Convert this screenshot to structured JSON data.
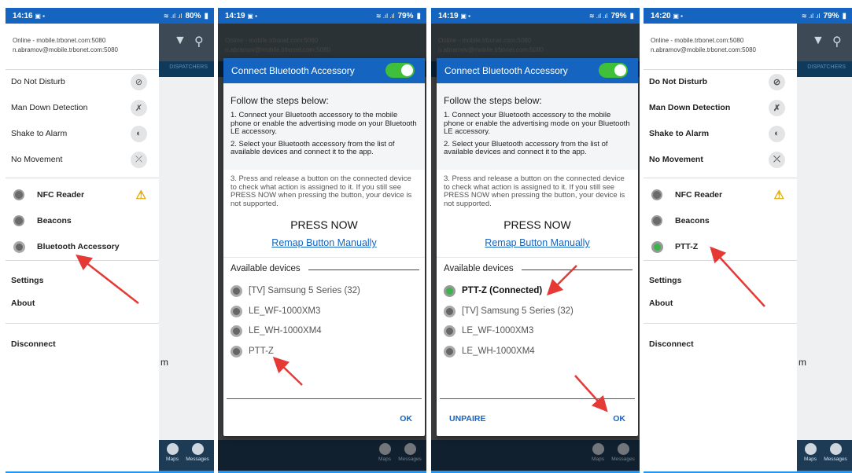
{
  "colors": {
    "accent": "#1565c0",
    "toggle_on": "#3fbf3a",
    "arrow": "#e53935",
    "warning": "#e0a800"
  },
  "icons": {
    "dnd": "ban-icon",
    "man_down": "man-down-icon",
    "shake": "shake-phone-icon",
    "no_movement": "no-movement-icon",
    "nfc": "nfc-icon",
    "beacons": "beacon-icon",
    "bluetooth": "bluetooth-accessory-icon",
    "warning": "warning-icon",
    "filter": "filter-icon",
    "search": "search-icon",
    "maps": "maps-icon",
    "messages": "messages-icon"
  },
  "screens": [
    {
      "status": {
        "time": "14:16",
        "battery": "80%"
      },
      "drawer": {
        "account_line1": "Online - mobile.trbonet.com:5080",
        "account_line2": "n.abramov@mobile.trbonet.com:5080",
        "toggles": [
          "Do Not Disturb",
          "Man Down Detection",
          "Shake to Alarm",
          "No Movement"
        ],
        "accessories": [
          "NFC Reader",
          "Beacons",
          "Bluetooth Accessory"
        ],
        "menu": [
          "Settings",
          "About"
        ],
        "disconnect": "Disconnect"
      },
      "bg_tab": "DISPATCHERS",
      "bg_fragment": "m",
      "nav": {
        "maps": "Maps",
        "messages": "Messages"
      }
    },
    {
      "status": {
        "time": "14:19",
        "battery": "79%"
      },
      "bg_account_line1": "Online - mobile.trbonet.com:5080",
      "bg_account_line2": "n.abramov@mobile.trbonet.com:5080",
      "dialog": {
        "title": "Connect Bluetooth Accessory",
        "steps_heading": "Follow the steps below:",
        "step1": "1. Connect your Bluetooth accessory to the mobile phone or enable the advertising mode on your Bluetooth LE accessory.",
        "step2": "2. Select your Bluetooth accessory from the list of available devices and connect it to the app.",
        "step3": "3. Press and release a button on the connected device to check what action is assigned to it. If you still see PRESS NOW when pressing the button, your device is not supported.",
        "press_now": "PRESS NOW",
        "remap": "Remap Button Manually",
        "available": "Available devices",
        "devices": [
          "[TV] Samsung 5 Series (32)",
          "LE_WF-1000XM3",
          "LE_WH-1000XM4",
          "PTT-Z"
        ],
        "ok": "OK"
      },
      "nav": {
        "maps": "Maps",
        "messages": "Messages"
      }
    },
    {
      "status": {
        "time": "14:19",
        "battery": "79%"
      },
      "bg_account_line1": "Online - mobile.trbonet.com:5080",
      "bg_account_line2": "n.abramov@mobile.trbonet.com:5080",
      "dialog": {
        "title": "Connect Bluetooth Accessory",
        "steps_heading": "Follow the steps below:",
        "step1": "1. Connect your Bluetooth accessory to the mobile phone or enable the advertising mode on your Bluetooth LE accessory.",
        "step2": "2. Select your Bluetooth accessory from the list of available devices and connect it to the app.",
        "step3": "3. Press and release a button on the connected device to check what action is assigned to it. If you still see PRESS NOW when pressing the button, your device is not supported.",
        "press_now": "PRESS NOW",
        "remap": "Remap Button Manually",
        "available": "Available devices",
        "devices": [
          "PTT-Z (Connected)",
          "[TV] Samsung 5 Series (32)",
          "LE_WF-1000XM3",
          "LE_WH-1000XM4"
        ],
        "unpaire": "UNPAIRE",
        "ok": "OK"
      },
      "nav": {
        "maps": "Maps",
        "messages": "Messages"
      }
    },
    {
      "status": {
        "time": "14:20",
        "battery": "79%"
      },
      "drawer": {
        "account_line1": "Online - mobile.trbonet.com:5080",
        "account_line2": "n.abramov@mobile.trbonet.com:5080",
        "toggles": [
          "Do Not Disturb",
          "Man Down Detection",
          "Shake to Alarm",
          "No Movement"
        ],
        "accessories": [
          "NFC Reader",
          "Beacons",
          "PTT-Z"
        ],
        "menu": [
          "Settings",
          "About"
        ],
        "disconnect": "Disconnect"
      },
      "bg_tab": "DISPATCHERS",
      "bg_fragment": "m",
      "nav": {
        "maps": "Maps",
        "messages": "Messages"
      }
    }
  ]
}
